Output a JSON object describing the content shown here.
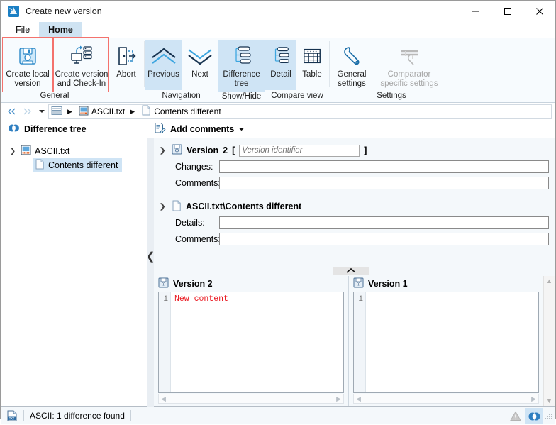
{
  "window": {
    "title": "Create new version",
    "app_icon": "compare-app-icon",
    "minimize": "minimize-icon",
    "maximize": "maximize-icon",
    "close": "close-icon"
  },
  "tabs": [
    {
      "label": "File",
      "active": false
    },
    {
      "label": "Home",
      "active": true
    }
  ],
  "ribbon": {
    "groups": [
      {
        "name": "General",
        "label": "General",
        "buttons": [
          {
            "id": "create-local-version",
            "label": "Create local version",
            "icon": "floppy-disk-icon",
            "selected": false,
            "disabled": false,
            "highlighted": true
          },
          {
            "id": "create-version-and-checkin",
            "label": "Create version and Check-In",
            "icon": "upload-to-server-icon",
            "selected": false,
            "disabled": false,
            "highlighted": true
          },
          {
            "id": "abort",
            "label": "Abort",
            "icon": "exit-door-icon",
            "selected": false,
            "disabled": false,
            "highlighted": false
          }
        ]
      },
      {
        "name": "Navigation",
        "label": "Navigation",
        "buttons": [
          {
            "id": "previous",
            "label": "Previous",
            "icon": "chevron-double-up-icon",
            "selected": true,
            "disabled": false,
            "highlighted": false
          },
          {
            "id": "next",
            "label": "Next",
            "icon": "chevron-double-down-icon",
            "selected": false,
            "disabled": false,
            "highlighted": false
          }
        ]
      },
      {
        "name": "Show/Hide",
        "label": "Show/Hide",
        "buttons": [
          {
            "id": "difference-tree",
            "label": "Difference tree",
            "icon": "tree-hierarchy-icon",
            "selected": true,
            "disabled": false,
            "highlighted": false
          }
        ]
      },
      {
        "name": "Compare view",
        "label": "Compare view",
        "buttons": [
          {
            "id": "detail",
            "label": "Detail",
            "icon": "tree-hierarchy-icon",
            "selected": true,
            "disabled": false,
            "highlighted": false
          },
          {
            "id": "table",
            "label": "Table",
            "icon": "table-grid-icon",
            "selected": false,
            "disabled": false,
            "highlighted": false
          }
        ]
      },
      {
        "name": "Settings",
        "label": "Settings",
        "buttons": [
          {
            "id": "general-settings",
            "label": "General settings",
            "icon": "wrench-icon",
            "selected": false,
            "disabled": false,
            "highlighted": false
          },
          {
            "id": "comparator-specific-settings",
            "label": "Comparator specific settings",
            "icon": "wrench-sliders-icon",
            "selected": false,
            "disabled": true,
            "highlighted": false
          }
        ]
      }
    ]
  },
  "breadcrumb": {
    "back_icon": "double-chevron-left-icon",
    "forward_icon": "double-chevron-right-icon",
    "dropdown_icon": "chevron-down-icon",
    "root_icon": "list-rows-icon",
    "items": [
      {
        "label": "ASCII.txt",
        "icon": "ascii-file-icon"
      },
      {
        "label": "Contents different",
        "icon": "document-diff-icon"
      }
    ]
  },
  "panels": {
    "difference_tree": {
      "title": "Difference tree",
      "title_icon": "difference-circles-icon",
      "nodes": [
        {
          "label": "ASCII.txt",
          "icon": "ascii-file-icon",
          "expanded": true,
          "children": [
            {
              "label": "Contents different",
              "icon": "document-diff-icon",
              "selected": true
            }
          ]
        }
      ]
    },
    "add_comments": {
      "label": "Add comments",
      "icon": "comment-note-icon",
      "dropdown_icon": "caret-down-icon"
    }
  },
  "form": {
    "version_section": {
      "expanded": true,
      "icon": "floppy-disk-icon",
      "title": "Version",
      "number": "2",
      "bracket_open": "[",
      "bracket_close": "]",
      "identifier_placeholder": "Version identifier",
      "identifier_value": "",
      "fields": [
        {
          "label": "Changes:",
          "value": ""
        },
        {
          "label": "Comments:",
          "value": ""
        }
      ]
    },
    "file_section": {
      "expanded": true,
      "icon": "document-diff-icon",
      "title": "ASCII.txt\\Contents different",
      "fields": [
        {
          "label": "Details:",
          "value": ""
        },
        {
          "label": "Comments:",
          "value": ""
        }
      ]
    }
  },
  "compare": {
    "collapse_handle_icon": "chevron-up-icon",
    "panes": [
      {
        "title": "Version 2",
        "icon": "floppy-disk-icon",
        "lines": [
          {
            "number": "1",
            "text": "New content",
            "status": "added"
          }
        ]
      },
      {
        "title": "Version 1",
        "icon": "floppy-disk-icon",
        "lines": [
          {
            "number": "1",
            "text": "",
            "status": "empty"
          }
        ]
      }
    ]
  },
  "statusbar": {
    "icon": "txt-file-icon",
    "text": "ASCII: 1 difference found",
    "warning_icon": "warning-triangle-icon",
    "difference_icon": "difference-circles-icon",
    "resize_grip": "resize-grip-icon"
  },
  "colors": {
    "accent": "#1b7fc4",
    "tab_active_bg": "#cfe3f2",
    "selection_bg": "#cfe4f5",
    "highlight_border": "#f4726d",
    "added_text": "#ea1c24",
    "ribbon_bg": "#f7fbfe"
  }
}
